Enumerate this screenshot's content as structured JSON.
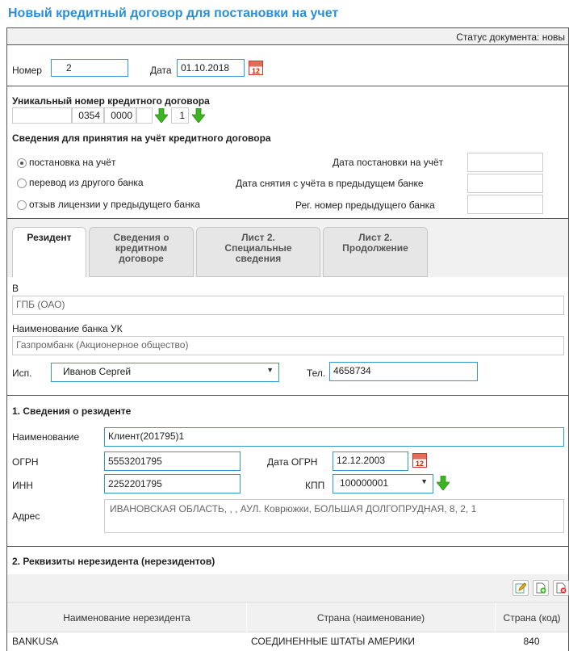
{
  "page": {
    "title": "Новый кредитный договор для постановки на учет",
    "status_label": "Статус документа: новы"
  },
  "header": {
    "number_label": "Номер",
    "number_value": "2",
    "date_label": "Дата",
    "date_value": "01.10.2018",
    "calendar_glyph": "12"
  },
  "unique": {
    "title": "Уникальный номер кредитного договора",
    "parts": [
      "",
      "0354",
      "0000",
      "",
      "1"
    ]
  },
  "registration": {
    "title": "Сведения для принятия на учёт кредитного договора",
    "options": [
      {
        "label": "постановка на учёт",
        "selected": true
      },
      {
        "label": "перевод из другого банка",
        "selected": false
      },
      {
        "label": "отзыв лицензии у предыдущего банка",
        "selected": false
      }
    ],
    "fields": [
      {
        "label": "Дата постановки на учёт",
        "value": ""
      },
      {
        "label": "Дата снятия с учёта в предыдущем банке",
        "value": ""
      },
      {
        "label": "Рег. номер предыдущего банка",
        "value": ""
      }
    ]
  },
  "tabs": [
    {
      "label": "Резидент",
      "active": true
    },
    {
      "label": "Сведения о кредитном договоре",
      "active": false
    },
    {
      "label": "Лист 2. Специальные сведения",
      "active": false
    },
    {
      "label": "Лист 2. Продолжение",
      "active": false
    }
  ],
  "resident_tab": {
    "to_label": "В",
    "bank_value": "ГПБ (ОАО)",
    "uk_bank_label": "Наименование банка УК",
    "uk_bank_value": "Газпромбанк (Акционерное общество)",
    "executor_label": "Исп.",
    "executor_value": "Иванов Сергей",
    "phone_label": "Тел.",
    "phone_value": "4658734"
  },
  "section1": {
    "title": "1. Сведения о резиденте",
    "name_label": "Наименование",
    "name_value": "Клиент(201795)1",
    "ogrn_label": "ОГРН",
    "ogrn_value": "5553201795",
    "ogrn_date_label": "Дата ОГРН",
    "ogrn_date_value": "12.12.2003",
    "inn_label": "ИНН",
    "inn_value": "2252201795",
    "kpp_label": "КПП",
    "kpp_value": "100000001",
    "address_label": "Адрес",
    "address_value": "ИВАНОВСКАЯ ОБЛАСТЬ, , , АУЛ. Коврюжки, БОЛЬШАЯ ДОЛГОПРУДНАЯ, 8, 2, 1"
  },
  "section2": {
    "title": "2. Реквизиты нерезидента (нерезидентов)",
    "toolbar_icons": [
      "edit-icon",
      "add-icon",
      "delete-icon"
    ],
    "columns": [
      "Наименование нерезидента",
      "Страна (наименование)",
      "Страна (код)"
    ],
    "rows": [
      {
        "name": "BANKUSA",
        "country": "СОЕДИНЕННЫЕ ШТАТЫ АМЕРИКИ",
        "code": "840"
      }
    ]
  },
  "colors": {
    "title": "#2a8fd6",
    "field_border": "#3399cc",
    "arrow": "#3cb521",
    "panel_bg": "#f1f1f1"
  }
}
